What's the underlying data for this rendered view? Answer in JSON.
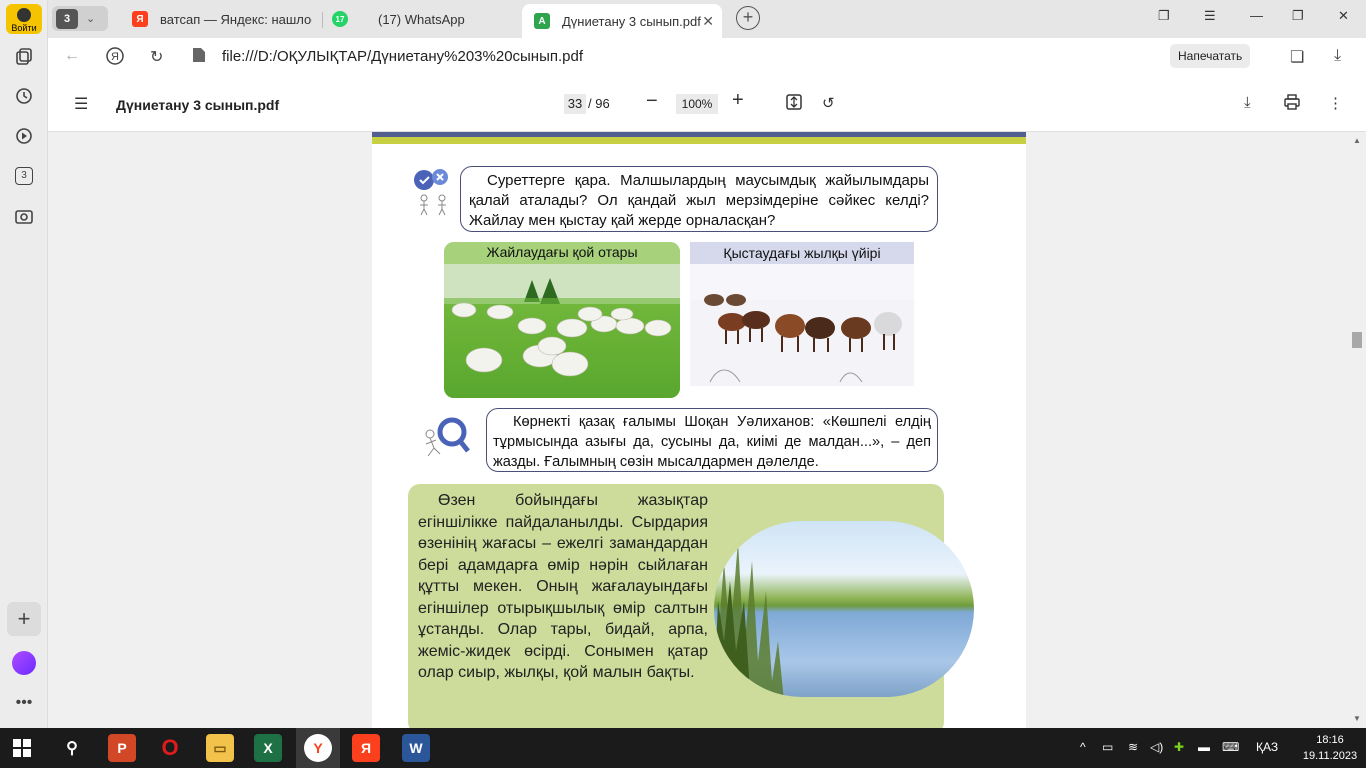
{
  "sidebar": {
    "login_label": "Войти",
    "badge_label": "3"
  },
  "tabs": {
    "counter": "3",
    "items": [
      {
        "label": "ватсап — Яндекс: нашлос",
        "favicon": "Я",
        "color": "#fc3f1d"
      },
      {
        "label": "(17) WhatsApp",
        "favicon": "17",
        "color": "#25d366"
      },
      {
        "label": "Дүниетану 3 сынып.pdf",
        "favicon": "A",
        "color": "#2ea44f"
      }
    ]
  },
  "address": {
    "url": "file:///D:/ОҚУЛЫҚТАР/Дүниетану%203%20сынып.pdf",
    "print_label": "Напечатать"
  },
  "pdf_toolbar": {
    "title": "Дүниетану 3 сынып.pdf",
    "current_page": "33",
    "total_pages": "/ 96",
    "zoom": "100%"
  },
  "page": {
    "question1": "Суреттерге қара. Малшылардың маусымдық жайылымдары қалай аталады? Ол қандай жыл мерзімдеріне сәйкес келді? Жайлау мен қыстау қай жерде орналасқан?",
    "caption_sheep": "Жайлаудағы қой отары",
    "caption_horse": "Қыстаудағы жылқы үйірі",
    "question2": "Көрнекті қазақ ғалымы Шоқан Уәлиханов: «Көшпелі елдің тұрмысында азығы да, сусыны да, киімі де малдан...», – деп жазды. Ғалымның сөзін мысалдармен дәлелде.",
    "paragraph": "Өзен бойындағы жазықтар егіншілікке пайдаланылды. Сырдария өзенінің жағасы – ежелгі замандардан бері адамдарға өмір нәрін сыйлаған құтты мекен. Оның жағалауындағы егіншілер отырықшылық өмір салтын ұстанды. Олар тары, бидай, арпа, жеміс-жидек өсірді. Сонымен қатар олар сиыр, жылқы, қой малын бақты."
  },
  "taskbar": {
    "lang": "ҚАЗ",
    "time": "18:16",
    "date": "19.11.2023"
  }
}
